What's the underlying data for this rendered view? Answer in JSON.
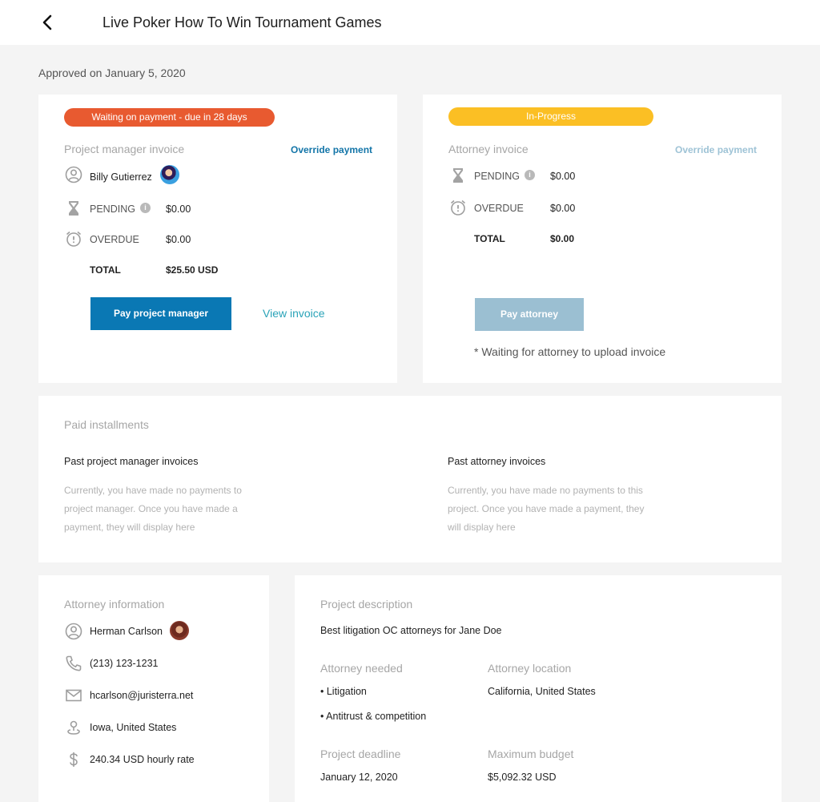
{
  "header": {
    "title": "Live Poker How To Win Tournament Games"
  },
  "approved_text": "Approved on January 5, 2020",
  "pm_card": {
    "status_pill": "Waiting on payment - due in 28 days",
    "label": "Project manager invoice",
    "override": "Override payment",
    "manager_name": "Billy Gutierrez",
    "pending_label": "PENDING",
    "pending_value": "$0.00",
    "overdue_label": "OVERDUE",
    "overdue_value": "$0.00",
    "total_label": "TOTAL",
    "total_value": "$25.50 USD",
    "pay_button": "Pay project manager",
    "view_invoice": "View invoice"
  },
  "attorney_card": {
    "status_pill": "In-Progress",
    "label": "Attorney invoice",
    "override": "Override payment",
    "pending_label": "PENDING",
    "pending_value": "$0.00",
    "overdue_label": "OVERDUE",
    "overdue_value": "$0.00",
    "total_label": "TOTAL",
    "total_value": "$0.00",
    "pay_button": "Pay attorney",
    "note": "* Waiting for attorney to upload invoice"
  },
  "installments": {
    "label": "Paid installments",
    "pm_title": "Past project manager invoices",
    "pm_text_1": "Currently, you have made no payments to",
    "pm_text_2": "project manager. Once you have made a",
    "pm_text_3": "payment, they will display here",
    "att_title": "Past attorney invoices",
    "att_text_1": "Currently, you have made no payments to this",
    "att_text_2": "project. Once you have made a payment, they",
    "att_text_3": "will display here"
  },
  "attorney_info": {
    "label": "Attorney information",
    "name": "Herman Carlson",
    "phone": "(213) 123-1231",
    "email": "hcarlson@juristerra.net",
    "location": "Iowa, United States",
    "rate": "240.34 USD hourly rate"
  },
  "project": {
    "desc_label": "Project description",
    "desc": "Best litigation OC attorneys for Jane Doe",
    "needed_label": "Attorney needed",
    "needed_1": "• Litigation",
    "needed_2": "• Antitrust & competition",
    "location_label": "Attorney location",
    "location": "California, United States",
    "deadline_label": "Project deadline",
    "deadline": "January 12, 2020",
    "budget_label": "Maximum budget",
    "budget": "$5,092.32 USD"
  },
  "colors": {
    "accent": "#0a78b4",
    "pill_warning": "#e85a30",
    "pill_progress": "#fbbf24",
    "pay_disabled": "#9bbfd2",
    "link": "#2aa3b8"
  }
}
